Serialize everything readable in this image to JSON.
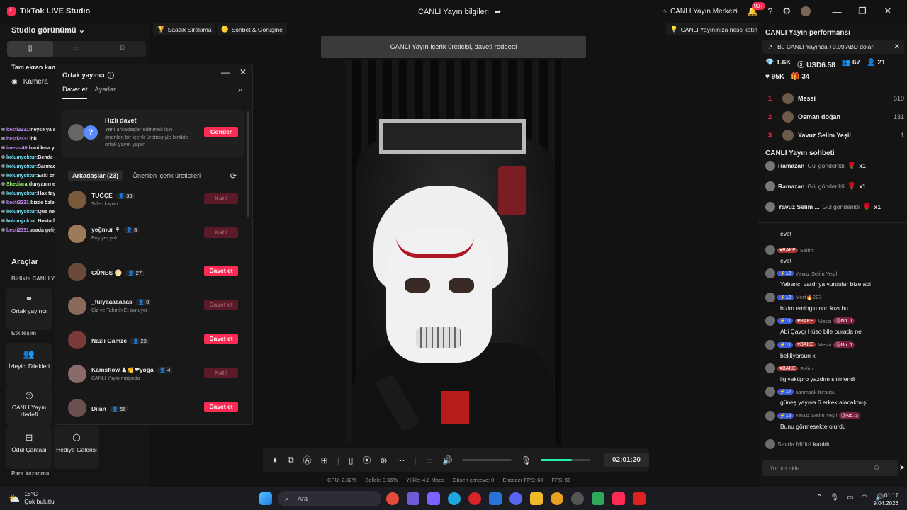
{
  "window": {
    "app_name": "TikTok LIVE Studio",
    "center_title": "CANLI Yayın bilgileri",
    "live_center": "CANLI Yayın Merkezi",
    "notif_badge": "99+"
  },
  "left": {
    "studio_view": "Studio görünümü",
    "scene_title": "Tam ekran kam",
    "camera_label": "Kamera",
    "tools_title": "Araçlar",
    "together_label": "Birlikte CANLI Y",
    "cohost_label": "Ortak yayıncı",
    "interaction_label": "Etkileşim",
    "viewer_requests": "İzleyici Dilekleri",
    "live_goal": "CANLI Yayın Hedefi",
    "reward_bag": "Ödül Çantası",
    "gift_gallery": "Hediye Galerisi",
    "monetize_label": "Para kazanma"
  },
  "chat_overlay": [
    {
      "user": "besti2331:",
      "text": "neyse ya sıktı bu"
    },
    {
      "user": "besti2331:",
      "text": "bb"
    },
    {
      "user": "imessi49:",
      "text": "hani kısa yayındı abi"
    },
    {
      "user": "kolumyoktur:",
      "text": "Bende gidiyom"
    },
    {
      "user": "kolumyoktur:",
      "text": "Sarmadı best"
    },
    {
      "user": "kolumyoktur:",
      "text": "Eski ortamı özledik"
    },
    {
      "user": "Shediara:",
      "text": "dunyanın en boktan yayını"
    },
    {
      "user": "kolumyoktur:",
      "text": "Hax tayfa"
    },
    {
      "user": "besti2331:",
      "text": "bizde özledik"
    },
    {
      "user": "kolumyoktur:",
      "text": "Que nerde"
    },
    {
      "user": "kolumyoktur:",
      "text": "Nokta falan"
    },
    {
      "user": "besti2331:",
      "text": "arada geliyo emekli damkentler"
    }
  ],
  "modal": {
    "title": "Ortak yayıncı",
    "tab_invite": "Davet et",
    "tab_settings": "Ayarlar",
    "quick_title": "Hızlı davet",
    "quick_desc": "Yeni arkadaşlar edinmek için önerilen bir içerik üreticisiyle birlikte ortak yayın yapın",
    "send_btn": "Gönder",
    "friends_tab": "Arkadaşlar (23)",
    "suggested_tab": "Önerilen içerik üreticileri",
    "friends": [
      {
        "name": "TUĞÇE",
        "count": "33",
        "sub": "Talep kapalı",
        "btn": "Katıl",
        "enabled": false
      },
      {
        "name": "yeğmur ⚘",
        "count": "8",
        "sub": "Boş yer yok",
        "btn": "Katıl",
        "enabled": false
      },
      {
        "name": "GÜNEŞ 🌕",
        "count": "27",
        "sub": "",
        "btn": "Davet et",
        "enabled": true
      },
      {
        "name": "_fulyaaaaaaas",
        "count": "8",
        "sub": "Çiz ve Tahmin Et oynuyor",
        "btn": "Davet et",
        "enabled": false
      },
      {
        "name": "Nazlı Gamze",
        "count": "23",
        "sub": "",
        "btn": "Davet et",
        "enabled": true
      },
      {
        "name": "Kamsflow ♟👏❤yoga",
        "count": "4",
        "sub": "CANLI Yayın maçında",
        "btn": "Katıl",
        "enabled": false
      },
      {
        "name": "Dilan",
        "count": "56",
        "sub": "",
        "btn": "Davet et",
        "enabled": true
      }
    ]
  },
  "top_chips": {
    "hourly_rank": "Saatlik Sıralama",
    "chat_meet": "Sohbet & Görüşme",
    "joy": "CANLI Yayınınıza neşe katın"
  },
  "notification": "CANLI Yayın içerik üreticisi, daveti reddetti",
  "controls": {
    "timer": "02:01:20",
    "mic_level": 0.63
  },
  "stats": {
    "cpu": "CPU:  2.82%",
    "mem": "Bellek:  0.66%",
    "upload": "Yükle:  4.0 Mbps",
    "dropped": "Düşen çerçeve:  0",
    "encoder": "Encoder FPS:  60",
    "fps": "FPS:  60"
  },
  "right": {
    "perf_title": "CANLI Yayın performansı",
    "earn_text": "Bu CANLI Yayında +0.09 ABD doları",
    "diamonds": "1.6K",
    "usd": "USD6.58",
    "viewers": "67",
    "follows": "21",
    "likes": "95K",
    "gifts": "34",
    "ranks": [
      {
        "n": "1",
        "name": "Messi",
        "score": "510"
      },
      {
        "n": "2",
        "name": "Osman doğan",
        "score": "131"
      },
      {
        "n": "3",
        "name": "Yavuz Selim Yeşil",
        "score": "1"
      }
    ],
    "chat_title": "CANLI Yayın sohbeti",
    "gift_rows": [
      {
        "user": "Ramazan",
        "action": "Gül gönderildi",
        "count": "x1"
      },
      {
        "user": "Ramazan",
        "action": "Gül gönderildi",
        "count": "x1"
      },
      {
        "user": "Yavuz Selim ...",
        "action": "Gül gönderildi",
        "count": "x1"
      }
    ],
    "messages": [
      {
        "lvl": "",
        "fan": "BAKE",
        "user": "Selim",
        "no": "",
        "text": "evet"
      },
      {
        "lvl": "12",
        "fan": "",
        "user": "Yavuz Selim Yeşil",
        "no": "",
        "text": "Yabancı vardı ya vurdular bize abi"
      },
      {
        "lvl": "12",
        "fan": "",
        "user": "Mert🔥227",
        "no": "",
        "text": "bizim emioglu nun kızı bu"
      },
      {
        "lvl": "11",
        "fan": "BAKE",
        "user": "Messi",
        "no": "No. 1",
        "text": "Abi Çayçı Hüso bile burada ne"
      },
      {
        "lvl": "11",
        "fan": "BAKE",
        "user": "Messi",
        "no": "No. 1",
        "text": "bekliyorsun ki"
      },
      {
        "lvl": "",
        "fan": "BAKE",
        "user": "Selim",
        "no": "",
        "text": "iigivaktipro yazdım sinirlendi"
      },
      {
        "lvl": "17",
        "fan": "",
        "user": "sanmsak turşusu",
        "no": "",
        "text": "güneş yayına 6 erkek alacakmışi"
      },
      {
        "lvl": "12",
        "fan": "",
        "user": "Yavuz Selim Yeşil",
        "no": "No. 3",
        "text": "Bunu görmesekte olurdu"
      }
    ],
    "first_msg_text": "evet",
    "joined_user": "Sevda Müftü",
    "joined_text": "katıldı",
    "comment_placeholder": "Yorum ekle"
  },
  "taskbar": {
    "temp": "16°C",
    "weather": "Çok bulutlu",
    "search": "Ara",
    "time": "01:17",
    "date": "9.04.2026"
  }
}
